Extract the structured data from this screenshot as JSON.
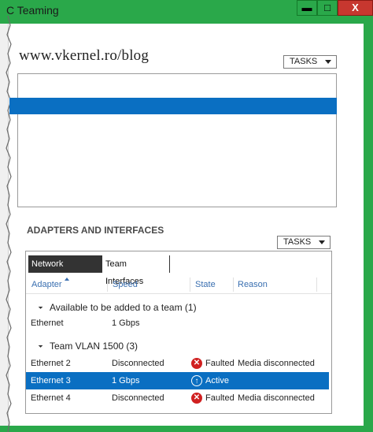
{
  "window": {
    "title": "C Teaming",
    "buttons": {
      "minimize": "▬",
      "maximize": "□",
      "close": "X"
    }
  },
  "watermark": "www.vkernel.ro/blog",
  "top_section": {
    "tasks_label": "TASKS"
  },
  "adapters_section": {
    "title": "ADAPTERS AND INTERFACES",
    "tasks_label": "TASKS",
    "tabs": [
      {
        "label": "Network Adapters",
        "selected": true
      },
      {
        "label": "Team Interfaces",
        "selected": false
      }
    ],
    "columns": [
      "Adapter",
      "Speed",
      "State",
      "Reason"
    ],
    "groups": [
      {
        "label": "Available to be added to a team (1)",
        "rows": [
          {
            "adapter": "Ethernet",
            "speed": "1 Gbps",
            "state": "",
            "reason": ""
          }
        ]
      },
      {
        "label": "Team VLAN 1500 (3)",
        "rows": [
          {
            "adapter": "Ethernet 2",
            "speed": "Disconnected",
            "state": "Faulted",
            "reason": "Media disconnected"
          },
          {
            "adapter": "Ethernet 3",
            "speed": "1 Gbps",
            "state": "Active",
            "reason": ""
          },
          {
            "adapter": "Ethernet 4",
            "speed": "Disconnected",
            "state": "Faulted",
            "reason": "Media disconnected"
          }
        ]
      }
    ]
  },
  "icons": {
    "faulted": "faulted-icon",
    "active": "active-icon",
    "sort": "sort-ascending-icon",
    "dropdown": "chevron-down-icon"
  },
  "colors": {
    "accent": "#0a6fc2",
    "frame": "#2aa84a",
    "close": "#c7372f",
    "fault": "#d02020"
  }
}
